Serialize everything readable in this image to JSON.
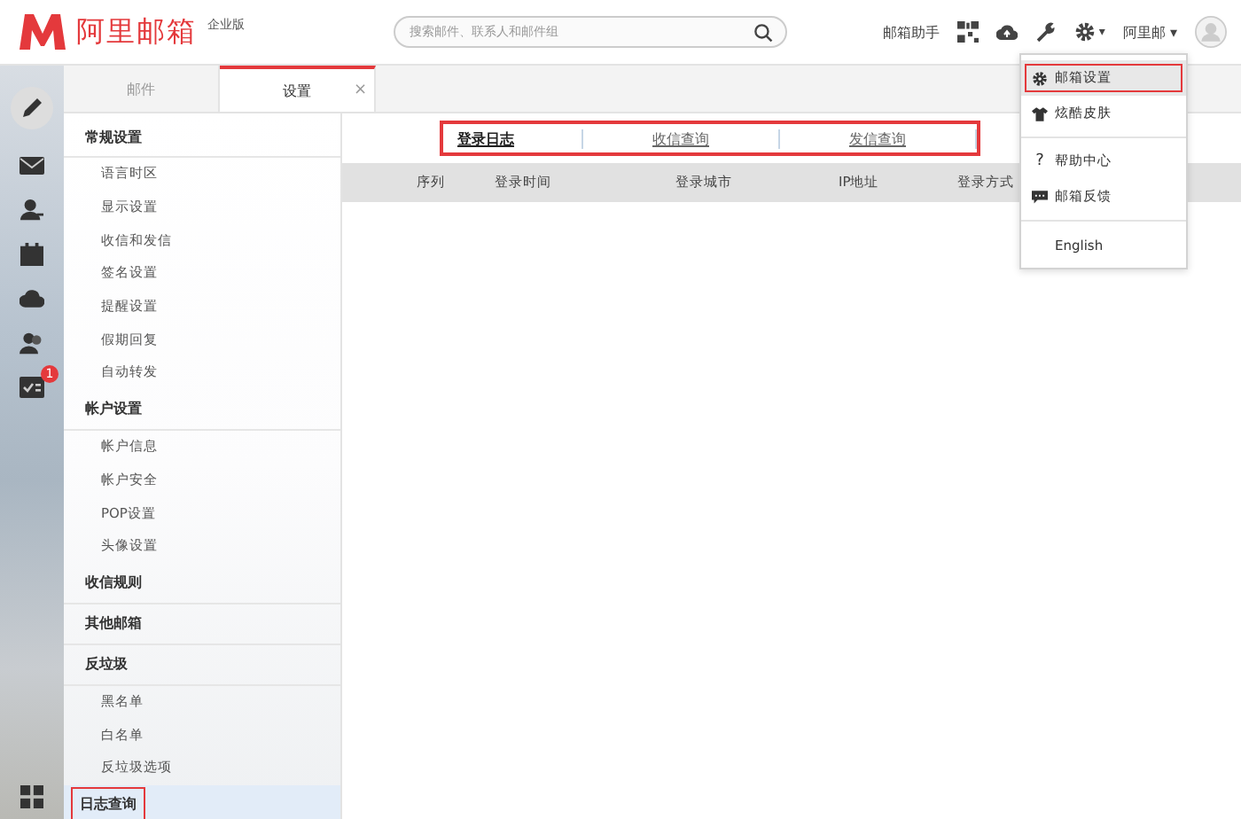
{
  "header": {
    "logo": "阿里邮箱",
    "edition": "企业版",
    "search": {
      "placeholder": "搜索邮件、联系人和邮件组"
    },
    "assistant": "邮箱助手",
    "user": "阿里邮",
    "user_caret": "▾",
    "settings_caret": "▾"
  },
  "rail": {
    "badge": "1"
  },
  "tabs": [
    {
      "label": "邮件",
      "selected": false
    },
    {
      "label": "设置",
      "selected": true,
      "close": "×"
    }
  ],
  "sidebar": {
    "groups": [
      {
        "label": "常规设置",
        "selected": false,
        "annotated": false,
        "children": [
          {
            "label": "语言时区"
          },
          {
            "label": "显示设置"
          },
          {
            "label": "收信和发信"
          },
          {
            "label": "签名设置"
          },
          {
            "label": "提醒设置"
          },
          {
            "label": "假期回复"
          },
          {
            "label": "自动转发"
          }
        ]
      },
      {
        "label": "帐户设置",
        "selected": false,
        "annotated": false,
        "children": [
          {
            "label": "帐户信息"
          },
          {
            "label": "帐户安全"
          },
          {
            "label": "POP设置"
          },
          {
            "label": "头像设置"
          }
        ]
      },
      {
        "label": "收信规则",
        "selected": false,
        "annotated": false
      },
      {
        "label": "其他邮箱",
        "selected": false,
        "annotated": false
      },
      {
        "label": "反垃圾",
        "selected": false,
        "annotated": false,
        "children": [
          {
            "label": "黑名单"
          },
          {
            "label": "白名单"
          },
          {
            "label": "反垃圾选项"
          }
        ]
      },
      {
        "label": "日志查询",
        "selected": true,
        "annotated": true
      }
    ]
  },
  "subtabs": {
    "annotated": true,
    "items": [
      {
        "label": "登录日志",
        "selected": true
      },
      {
        "label": "收信查询",
        "selected": false
      },
      {
        "label": "发信查询",
        "selected": false
      }
    ]
  },
  "table": {
    "columns": [
      "序列",
      "登录时间",
      "登录城市",
      "IP地址",
      "登录方式"
    ]
  },
  "menu": {
    "items": [
      {
        "kind": "gear",
        "label": "邮箱设置",
        "selected": true,
        "annotated": true
      },
      {
        "kind": "shirt",
        "label": "炫酷皮肤",
        "selected": false,
        "annotated": false
      },
      {
        "kind": "divider"
      },
      {
        "kind": "help",
        "icon": "?",
        "label": "帮助中心",
        "selected": false,
        "annotated": false
      },
      {
        "kind": "chat",
        "label": "邮箱反馈",
        "selected": false,
        "annotated": false
      },
      {
        "kind": "divider"
      },
      {
        "kind": "plain",
        "label": "English",
        "selected": false,
        "annotated": false
      }
    ]
  }
}
